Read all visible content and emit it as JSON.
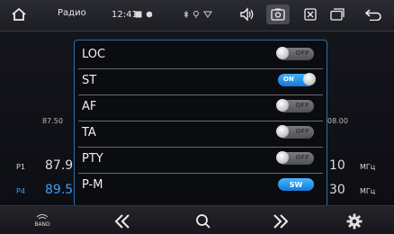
{
  "status_bar": {
    "title": "Радио",
    "time": "12:41"
  },
  "radio_display": {
    "scale_left": "87.50",
    "scale_right": "08.00",
    "unit": "МГц",
    "presets": [
      {
        "label": "P1",
        "freq_visible": "87.9",
        "freq_right": "10"
      },
      {
        "label": "P4",
        "freq_visible": "89.5",
        "freq_right": "30"
      }
    ]
  },
  "settings": {
    "rows": [
      {
        "label": "LOC",
        "state": "OFF"
      },
      {
        "label": "ST",
        "state": "ON"
      },
      {
        "label": "AF",
        "state": "OFF"
      },
      {
        "label": "TA",
        "state": "OFF"
      },
      {
        "label": "PTY",
        "state": "OFF"
      },
      {
        "label": "P-M",
        "state": "SW"
      }
    ]
  },
  "bottom_bar": {
    "band_label": "BAND"
  },
  "colors": {
    "accent": "#2b9bff",
    "modal_border": "#2b6fb0",
    "preset_active": "#3aa0ff"
  }
}
